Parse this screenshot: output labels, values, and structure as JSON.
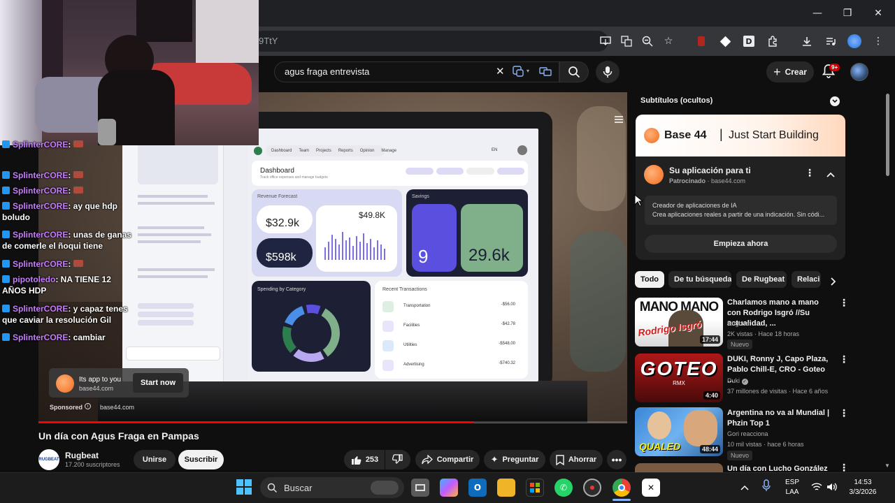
{
  "browser": {
    "url_fragment": "9TtY",
    "window_controls": {
      "minimize": "—",
      "maximize": "❐",
      "close": "✕"
    }
  },
  "youtube": {
    "search_query": "agus fraga entrevista",
    "create_label": "Crear",
    "notification_count": "9+"
  },
  "chat": [
    {
      "user": "SplinterCORE",
      "text": ": ",
      "emote": true
    },
    {
      "user": "SplinterCORE",
      "text": ": ",
      "emote": true
    },
    {
      "user": "SplinterCORE",
      "text": ": ",
      "emote": true
    },
    {
      "user": "SplinterCORE",
      "text": ": ay que hdp boludo"
    },
    {
      "user": "SplinterCORE",
      "text": ": unas de ganas de comerle el ñoqui tiene"
    },
    {
      "user": "SplinterCORE",
      "text": ": ",
      "emote": true
    },
    {
      "user": "pipotoledo",
      "text": ": NA TIENE 12 AÑOS HDP"
    },
    {
      "user": "SplinterCORE",
      "text": ": y capaz tenes que caviar la resolución Gil"
    },
    {
      "user": "SplinterCORE",
      "text": ": cambiar"
    }
  ],
  "video": {
    "title": "Un día con Agus Fraga en Pampas",
    "progress": 0.74,
    "ad_overlay": {
      "text": "Its app to you",
      "domain": "base44.com",
      "cta": "Start now",
      "sponsored": "Sponsored",
      "sponsored_domain": "base44.com"
    },
    "dashboard": {
      "heading": "Dashboard",
      "subheading": "Track office expenses and manage budgets",
      "nav": [
        "Dashboard",
        "Team",
        "Projects",
        "Reports",
        "Opinion",
        "Manage"
      ],
      "lang": "EN",
      "revenue_label": "Revenue Forecast",
      "value_1": "$32.9k",
      "value_2": "$598k",
      "value_3": "$49.8K",
      "savings_label": "Savings",
      "savings_1": "9",
      "savings_2": "29.6k",
      "spending_label": "Spending by Category",
      "transactions_label": "Recent Transactions",
      "transactions": [
        {
          "name": "Transportation",
          "amount": "-$56.00"
        },
        {
          "name": "Facilities",
          "amount": "-$42.78"
        },
        {
          "name": "Utilities",
          "amount": "-$548.00"
        },
        {
          "name": "Advertising",
          "amount": "-$740.32"
        }
      ]
    }
  },
  "channel": {
    "name": "Rugbeat",
    "subscribers": "17.200 suscriptores",
    "avatar_text": "RUGBEAT",
    "join_label": "Unirse",
    "subscribe_label": "Suscribir"
  },
  "actions": {
    "likes": "253",
    "share": "Compartir",
    "ask": "Preguntar",
    "save": "Ahorrar"
  },
  "sidebar": {
    "subtitles_label": "Subtítulos (ocultos)",
    "ad": {
      "brand": "Base 44",
      "slogan": "Just Start Building",
      "title": "Su aplicación para ti",
      "sponsored": "Patrocinado",
      "domain": "base44.com",
      "desc_title": "Creador de aplicaciones de IA",
      "desc_body": "Crea aplicaciones reales a partir de una indicación.  Sin códi...",
      "cta": "Empieza ahora"
    },
    "chips": [
      "Todo",
      "De tu búsqueda",
      "De Rugbeat",
      "Relaci"
    ],
    "recommendations": [
      {
        "title": "Charlamos mano a mano con Rodrigo Isgró //Su actualidad, ...",
        "channel": "Rugbeat",
        "meta": "2K vistas · Hace 18 horas",
        "duration": "17:44",
        "badge": "Nuevo",
        "thumb_text": "MANO MANO",
        "thumb_sub": "Rodrigo Isgró"
      },
      {
        "title": "DUKI, Ronny J, Capo Plaza, Pablo Chill-E, CRO - Goteo ...",
        "channel": "Duki",
        "meta": "37 millones de visitas · Hace 6 años",
        "duration": "4:40",
        "thumb_text": "GOTEO",
        "thumb_sub": "RMX"
      },
      {
        "title": "Argentina no va al Mundial | Phzin Top 1",
        "channel": "Gori reacciona",
        "meta": "10 mil vistas · hace 6 horas",
        "duration": "48:44",
        "badge": "Nuevo",
        "thumb_text": "QUALED"
      },
      {
        "title": "Un día con Lucho González"
      }
    ]
  },
  "taskbar": {
    "search_label": "Buscar",
    "lang_top": "ESP",
    "lang_bottom": "LAA",
    "time": "14:53",
    "date": "3/3/2026"
  },
  "colors": {
    "accent_red": "#ff0000",
    "chat_name": "#c77dff",
    "dashboard_purple": "#5b4fe0",
    "dashboard_green": "#7fb08a"
  }
}
